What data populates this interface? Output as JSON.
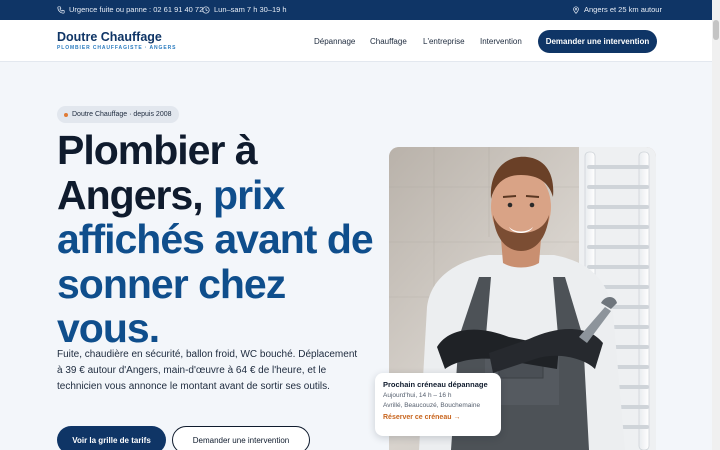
{
  "topbar": {
    "emergency": "Urgence fuite ou panne : 02 61 91 40 72",
    "hours": "Lun–sam 7 h 30–19 h",
    "area": "Angers et 25 km autour",
    "icons": {
      "phone": "phone-icon",
      "clock": "clock-icon",
      "location": "location-pin-icon"
    }
  },
  "header": {
    "logo_title": "Doutre Chauffage",
    "logo_subtitle": "PLOMBIER CHAUFFAGISTE · ANGERS",
    "nav": [
      "Dépannage",
      "Chauffage",
      "L'entreprise",
      "Intervention"
    ],
    "cta": "Demander une intervention"
  },
  "hero": {
    "badge": "Doutre Chauffage · depuis 2008",
    "title_dark_1": "Plombier à",
    "title_dark_2": "Angers, ",
    "title_accent": "prix affichés avant de sonner chez vous.",
    "lead": "Fuite, chaudière en sécurité, ballon froid, WC bouché. Déplacement à 39 € autour d'Angers, main-d'œuvre à 64 € de l'heure, et le technicien vous annonce le montant avant de sortir ses outils.",
    "btn_primary": "Voir la grille de tarifs",
    "btn_secondary": "Demander une intervention"
  },
  "slot_card": {
    "title": "Prochain créneau dépannage",
    "time": "Aujourd'hui, 14 h – 16 h",
    "places": "Avrillé, Beaucouzé, Bouchemaine",
    "link": "Réserver ce créneau →"
  },
  "colors": {
    "navy": "#0f3566",
    "accent_blue": "#0f4e8c",
    "orange": "#c8651e",
    "background": "#f3f6fa"
  }
}
